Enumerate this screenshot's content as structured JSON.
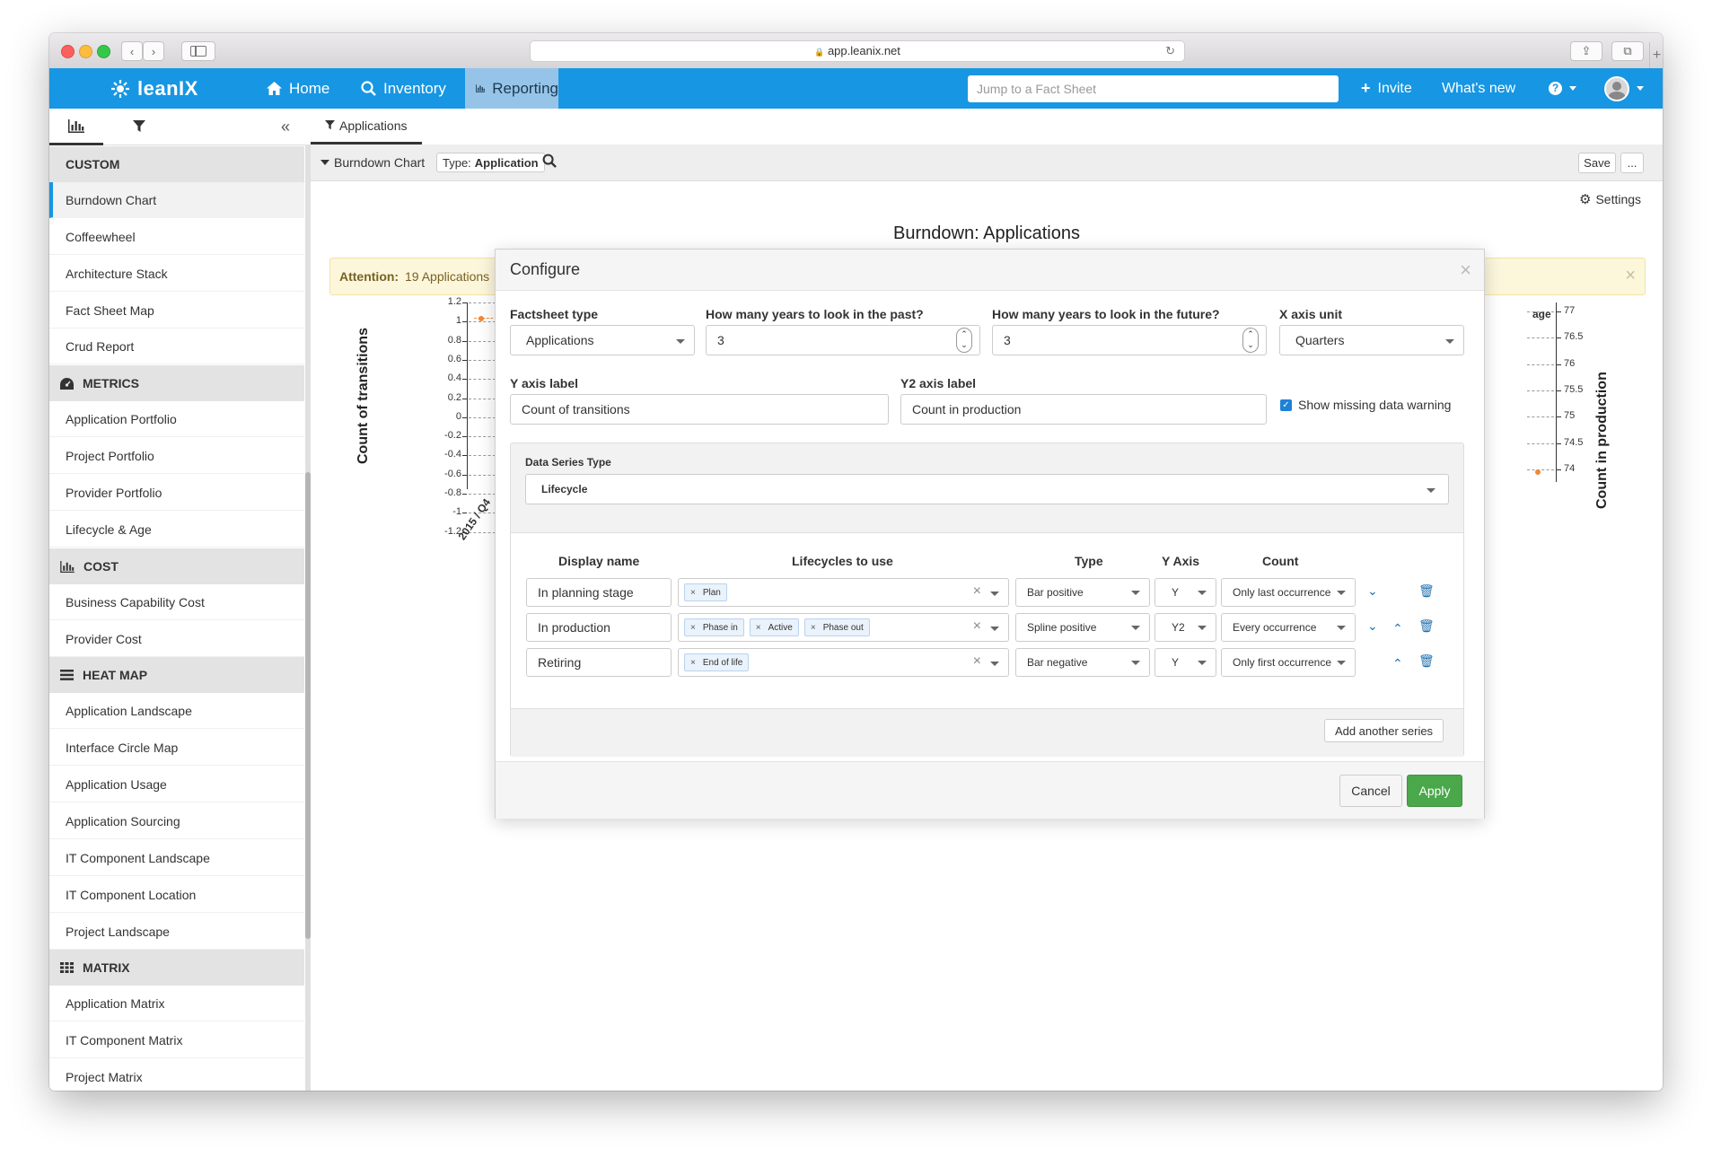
{
  "browser": {
    "url": "app.leanix.net",
    "lock_icon": "🔒",
    "back_icon": "‹",
    "forward_icon": "›",
    "reload_icon": "↻",
    "share_icon": "⇪",
    "tabs_icon": "⧉",
    "new_tab_icon": "+"
  },
  "nav": {
    "logo": "leanIX",
    "home": "Home",
    "inventory": "Inventory",
    "reporting": "Reporting",
    "search_placeholder": "Jump to a Fact Sheet",
    "invite": "Invite",
    "whats_new": "What's new",
    "help_icon": "?"
  },
  "sidebar": {
    "collapse_icon": "«",
    "sections": [
      {
        "title": "CUSTOM",
        "icon": "",
        "items": [
          "Burndown Chart",
          "Coffeewheel",
          "Architecture Stack",
          "Fact Sheet Map",
          "Crud Report"
        ]
      },
      {
        "title": "METRICS",
        "icon": "dashboard-icon",
        "items": [
          "Application Portfolio",
          "Project Portfolio",
          "Provider Portfolio",
          "Lifecycle & Age"
        ]
      },
      {
        "title": "COST",
        "icon": "bar-chart-icon",
        "items": [
          "Business Capability Cost",
          "Provider Cost"
        ]
      },
      {
        "title": "HEAT MAP",
        "icon": "list-icon",
        "items": [
          "Application Landscape",
          "Interface Circle Map",
          "Application Usage",
          "Application Sourcing",
          "IT Component Landscape",
          "IT Component Location",
          "Project Landscape"
        ]
      },
      {
        "title": "MATRIX",
        "icon": "grid-icon",
        "items": [
          "Application Matrix",
          "IT Component Matrix",
          "Project Matrix"
        ]
      }
    ]
  },
  "content": {
    "tab_label": "Applications",
    "report_name": "Burndown Chart",
    "type_filter_prefix": "Type:",
    "type_filter_value": "Application",
    "save": "Save",
    "more": "...",
    "settings": "Settings",
    "chart_title": "Burndown: Applications",
    "attention_label": "Attention:",
    "attention_text": "19 Applications",
    "close_icon": "×"
  },
  "chart_data": {
    "type": "bar",
    "title": "Burndown: Applications",
    "ylabel": "Count of transitions",
    "y2label": "Count in production",
    "y_ticks": [
      "1.2",
      "1",
      "0.8",
      "0.6",
      "0.4",
      "0.2",
      "0",
      "-0.2",
      "-0.4",
      "-0.6",
      "-0.8",
      "-1",
      "-1.2"
    ],
    "y2_ticks": [
      "77",
      "76.5",
      "76",
      "75.5",
      "75",
      "74.5",
      "74"
    ],
    "x_first_label": "2015 / Q4",
    "ylim": [
      -1.2,
      1.2
    ],
    "y2lim": [
      74,
      77
    ],
    "legend_fragment": "age",
    "accent_color": "#f0883a"
  },
  "modal": {
    "title": "Configure",
    "factsheet_type_label": "Factsheet type",
    "factsheet_type_value": "Applications",
    "past_label": "How many years to look in the past?",
    "past_value": "3",
    "future_label": "How many years to look in the future?",
    "future_value": "3",
    "xunit_label": "X axis unit",
    "xunit_value": "Quarters",
    "y_label": "Y axis label",
    "y_value": "Count of transitions",
    "y2_label": "Y2 axis label",
    "y2_value": "Count in production",
    "missing_warning": "Show missing data warning",
    "data_series_type_label": "Data Series Type",
    "data_series_type_value": "Lifecycle",
    "col_display_name": "Display name",
    "col_lifecycles": "Lifecycles to use",
    "col_type": "Type",
    "col_yaxis": "Y Axis",
    "col_count": "Count",
    "rows": [
      {
        "name": "In planning stage",
        "lifecycles": [
          "Plan"
        ],
        "type": "Bar positive",
        "yaxis": "Y",
        "count": "Only last occurrence"
      },
      {
        "name": "In production",
        "lifecycles": [
          "Phase in",
          "Active",
          "Phase out"
        ],
        "type": "Spline positive",
        "yaxis": "Y2",
        "count": "Every occurrence"
      },
      {
        "name": "Retiring",
        "lifecycles": [
          "End of life"
        ],
        "type": "Bar negative",
        "yaxis": "Y",
        "count": "Only first occurrence"
      }
    ],
    "add_series": "Add another series",
    "cancel": "Cancel",
    "apply": "Apply"
  }
}
